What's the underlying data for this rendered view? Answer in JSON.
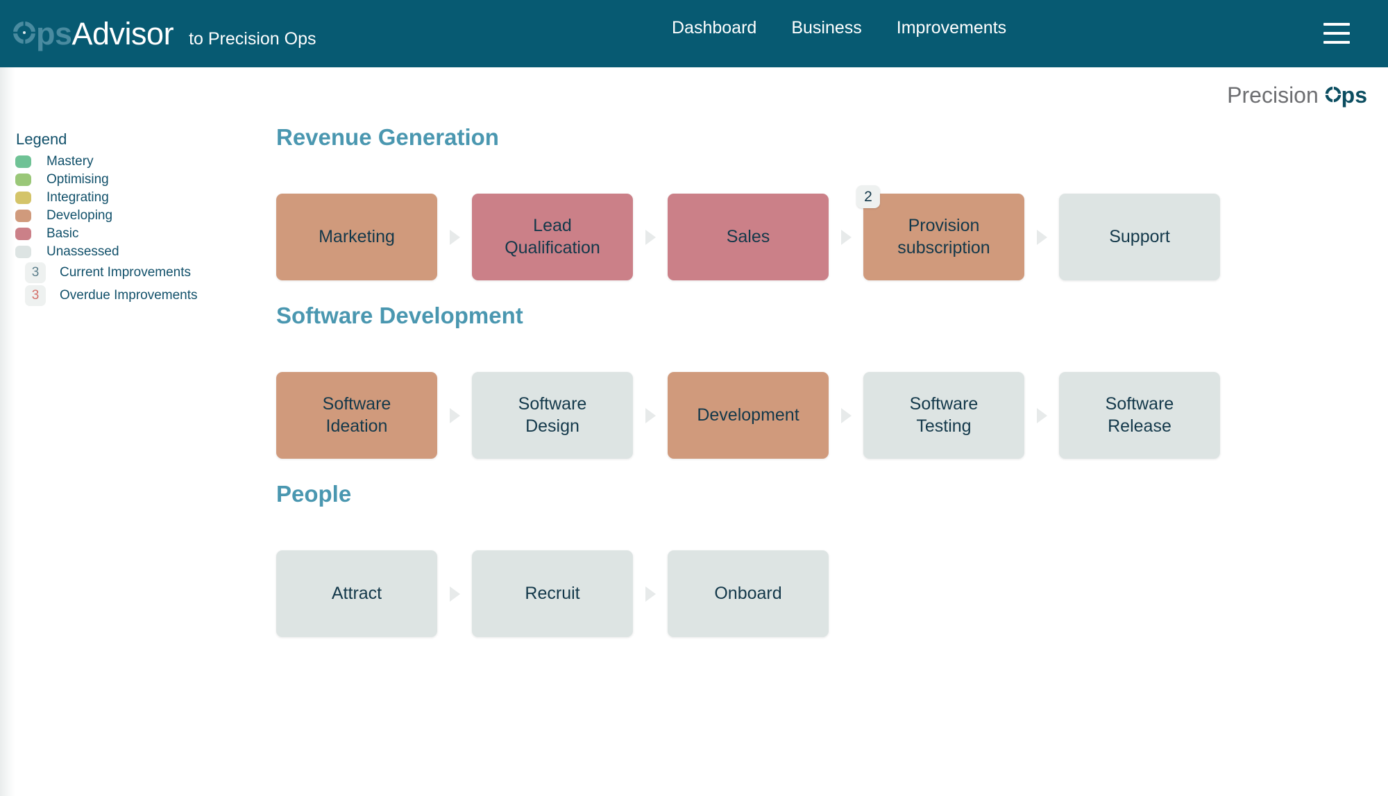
{
  "topbar": {
    "logo_ops": "Ops",
    "logo_advisor": "Advisor",
    "logo_subtitle": "to Precision Ops",
    "nav": [
      {
        "label": "Dashboard",
        "name": "nav-dashboard"
      },
      {
        "label": "Business",
        "name": "nav-business"
      },
      {
        "label": "Improvements",
        "name": "nav-improvements"
      }
    ],
    "menu_icon": "hamburger-menu-icon",
    "background": "#075a72"
  },
  "org_header": {
    "prefix": "Precision",
    "strong": "Ops"
  },
  "legend": {
    "title": "Legend",
    "maturity": [
      {
        "label": "Mastery",
        "color": "#6fc295"
      },
      {
        "label": "Optimising",
        "color": "#9ac778"
      },
      {
        "label": "Integrating",
        "color": "#d4c469"
      },
      {
        "label": "Developing",
        "color": "#d09a7c"
      },
      {
        "label": "Basic",
        "color": "#cb8088"
      },
      {
        "label": "Unassessed",
        "color": "#dde4e3"
      }
    ],
    "counts": [
      {
        "value": "3",
        "label": "Current Improvements",
        "color": "#5d7f8c"
      },
      {
        "value": "3",
        "label": "Overdue Improvements",
        "color": "#d4706a"
      }
    ]
  },
  "sections": [
    {
      "title": "Revenue Generation",
      "stages": [
        {
          "label": "Marketing",
          "maturity": "developing",
          "badge": null
        },
        {
          "label": "Lead\nQualification",
          "maturity": "basic",
          "badge": null
        },
        {
          "label": "Sales",
          "maturity": "basic",
          "badge": null
        },
        {
          "label": "Provision\nsubscription",
          "maturity": "developing",
          "badge": "2"
        },
        {
          "label": "Support",
          "maturity": "unassessed",
          "badge": null
        }
      ]
    },
    {
      "title": "Software Development",
      "stages": [
        {
          "label": "Software\nIdeation",
          "maturity": "developing",
          "badge": null
        },
        {
          "label": "Software\nDesign",
          "maturity": "unassessed",
          "badge": null
        },
        {
          "label": "Development",
          "maturity": "developing",
          "badge": null
        },
        {
          "label": "Software\nTesting",
          "maturity": "unassessed",
          "badge": null
        },
        {
          "label": "Software\nRelease",
          "maturity": "unassessed",
          "badge": null
        }
      ]
    },
    {
      "title": "People",
      "stages": [
        {
          "label": "Attract",
          "maturity": "unassessed",
          "badge": null
        },
        {
          "label": "Recruit",
          "maturity": "unassessed",
          "badge": null
        },
        {
          "label": "Onboard",
          "maturity": "unassessed",
          "badge": null
        }
      ]
    }
  ]
}
